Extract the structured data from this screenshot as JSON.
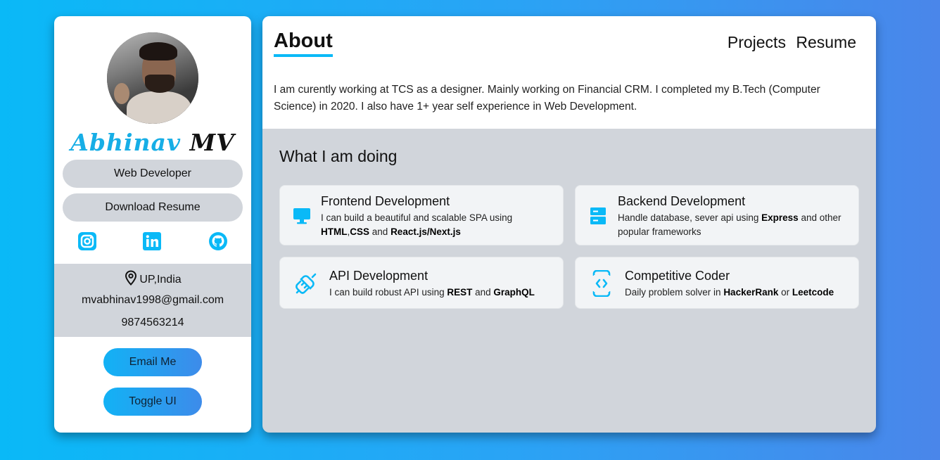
{
  "profile": {
    "first_name": "Abhinav",
    "last_name": "MV",
    "role": "Web Developer",
    "download_label": "Download Resume",
    "location": "UP,India",
    "email": "mvabhinav1998@gmail.com",
    "phone": "9874563214",
    "email_btn": "Email Me",
    "toggle_btn": "Toggle UI",
    "socials": [
      "instagram-icon",
      "linkedin-icon",
      "github-icon"
    ]
  },
  "header": {
    "title": "About",
    "nav": [
      "Projects",
      "Resume"
    ]
  },
  "about": {
    "bio": "I am curently working at TCS as a designer. Mainly working on Financial CRM. I completed my B.Tech (Computer Science) in 2020. I also have 1+ year self experience in Web Development."
  },
  "doing": {
    "title": "What I am doing",
    "cards": [
      {
        "icon": "monitor-icon",
        "title": "Frontend Development",
        "text_a": "I can build a beautiful and scalable SPA using ",
        "bold_a": "HTML",
        "text_b": ",",
        "bold_b": "CSS",
        "text_c": " and ",
        "bold_c": "React.js/Next.js"
      },
      {
        "icon": "server-icon",
        "title": "Backend Development",
        "text_a": "Handle database, sever api using ",
        "bold_a": "Express",
        "text_b": " and other popular frameworks"
      },
      {
        "icon": "plug-icon",
        "title": "API Development",
        "text_a": "I can build robust API using ",
        "bold_a": "REST",
        "text_b": " and ",
        "bold_b": "GraphQL"
      },
      {
        "icon": "code-icon",
        "title": "Competitive Coder",
        "text_a": "Daily problem solver in ",
        "bold_a": "HackerRank",
        "text_b": " or ",
        "bold_b": "Leetcode"
      }
    ]
  },
  "colors": {
    "accent": "#0ab9f7",
    "panel_gray": "#d1d5db",
    "card_bg": "#f2f4f6"
  }
}
